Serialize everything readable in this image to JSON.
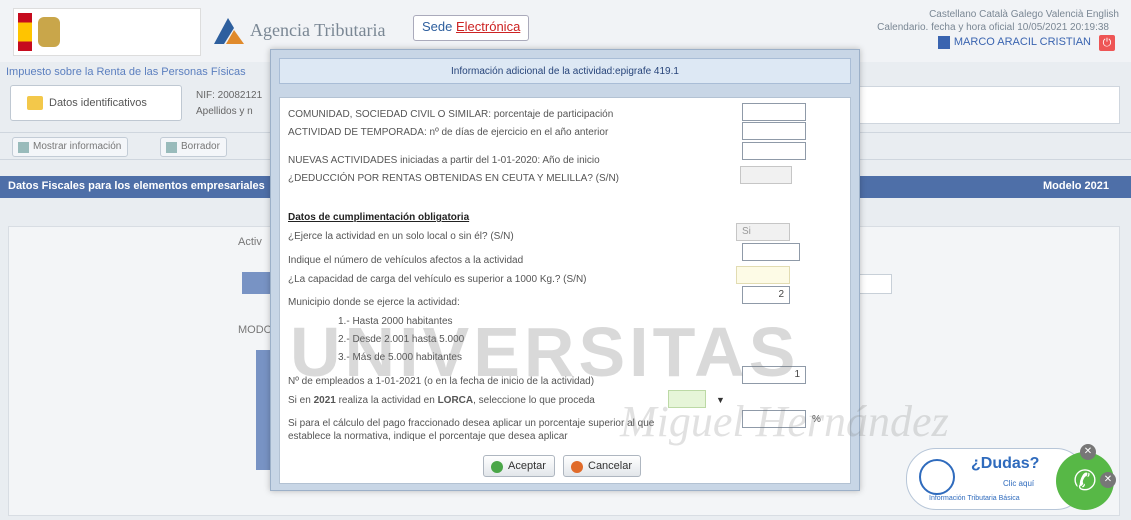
{
  "header": {
    "agency_name": "Agencia Tributaria",
    "sede_prefix": "Sede ",
    "sede_link": "Electrónica",
    "languages": "Castellano  Català  Galego  Valencià  English",
    "calendar": "Calendario. fecha y hora oficial 10/05/2021 20:19:38",
    "user_name": "MARCO ARACIL CRISTIAN"
  },
  "page": {
    "subtitle": "Impuesto sobre la Renta de las Personas Físicas",
    "tab_datos": "Datos identificativos",
    "nif_label": "NIF: 20082121",
    "apellidos_label": "Apellidos y n",
    "toolbar": {
      "mostrar_info": "Mostrar información",
      "borrador": "Borrador"
    },
    "blue_bar_left": "Datos Fiscales para los elementos empresariales",
    "blue_bar_right": "Modelo 2021",
    "activ_label": "Activ",
    "modo_label": "MODO"
  },
  "modal": {
    "title": "Información adicional de la actividad:epigrafe 419.1",
    "rows": {
      "comunidad": "COMUNIDAD, SOCIEDAD CIVIL O SIMILAR: porcentaje de participación",
      "temporada": "ACTIVIDAD DE TEMPORADA: nº de días de ejercicio en el año anterior",
      "nuevas": "NUEVAS ACTIVIDADES iniciadas a partir del 1-01-2020: Año de inicio",
      "deduccion": "¿DEDUCCIÓN POR RENTAS OBTENIDAS EN CEUTA Y MELILLA? (S/N)",
      "section_title": "Datos de cumplimentación obligatoria",
      "local": "¿Ejerce la actividad en un solo local o sin él? (S/N)",
      "vehiculos": "Indique el número de vehículos afectos a la actividad",
      "carga": "¿La capacidad de carga del vehículo es superior a 1000 Kg.? (S/N)",
      "municipio": "Municipio donde se ejerce la actividad:",
      "m1": "1.- Hasta 2000 habitantes",
      "m2": "2.- Desde 2.001 hasta 5.000",
      "m3": "3.- Más de 5.000 habitantes",
      "empleados": "Nº de empleados a 1-01-2021 (o en la fecha de inicio de la actividad)",
      "lorca_pre": "Si en ",
      "lorca_year": "2021",
      "lorca_mid": " realiza la actividad en ",
      "lorca_city": "LORCA",
      "lorca_post": ", seleccione lo que proceda",
      "fracc_1": "Si para el cálculo del pago fraccionado desea aplicar un porcentaje superior al que",
      "fracc_2": "establece la normativa, indique el porcentaje que desea aplicar"
    },
    "values": {
      "local": "Si",
      "municipio": "2",
      "empleados": "1"
    },
    "percent_sign": "%",
    "accept": "Aceptar",
    "cancel": "Cancelar"
  },
  "watermark": {
    "main": "UNIVERSITAS",
    "sub": "Miguel Hernández"
  },
  "help": {
    "question": "¿Dudas?",
    "click": "Clic aquí",
    "info": "Información Tributaria Básica"
  }
}
